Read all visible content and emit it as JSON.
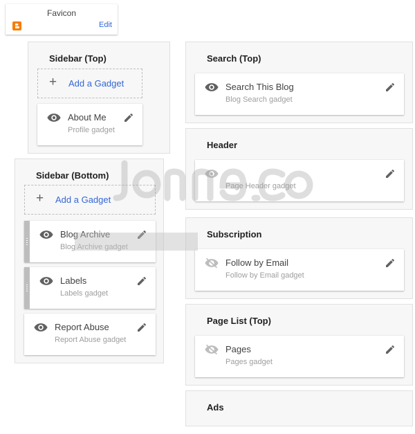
{
  "favicon": {
    "title": "Favicon",
    "edit_label": "Edit",
    "icon": "blogger-icon",
    "icon_color": "#f57d00"
  },
  "sidebar_top": {
    "title": "Sidebar (Top)",
    "add_gadget_label": "Add a Gadget",
    "gadgets": [
      {
        "name": "About Me",
        "type": "Profile gadget",
        "visible": true
      }
    ]
  },
  "sidebar_bottom": {
    "title": "Sidebar (Bottom)",
    "add_gadget_label": "Add a Gadget",
    "gadgets": [
      {
        "name": "Blog Archive",
        "type": "Blog Archive gadget",
        "visible": true
      },
      {
        "name": "Labels",
        "type": "Labels gadget",
        "visible": true
      },
      {
        "name": "Report Abuse",
        "type": "Report Abuse gadget",
        "visible": true
      }
    ]
  },
  "search_top": {
    "title": "Search (Top)",
    "gadgets": [
      {
        "name": "Search This Blog",
        "type": "Blog Search gadget",
        "visible": true
      }
    ]
  },
  "header": {
    "title": "Header",
    "gadgets": [
      {
        "name": "",
        "type": "Page Header gadget",
        "visible": true
      }
    ]
  },
  "subscription": {
    "title": "Subscription",
    "gadgets": [
      {
        "name": "Follow by Email",
        "type": "Follow by Email gadget",
        "visible": false
      }
    ]
  },
  "page_list_top": {
    "title": "Page List (Top)",
    "gadgets": [
      {
        "name": "Pages",
        "type": "Pages gadget",
        "visible": false
      }
    ]
  },
  "ads": {
    "title": "Ads"
  },
  "colors": {
    "accent": "#3367d6",
    "icon_grey": "#616161",
    "hidden_icon": "#bdbdbd",
    "panel_bg": "#f7f7f7"
  }
}
